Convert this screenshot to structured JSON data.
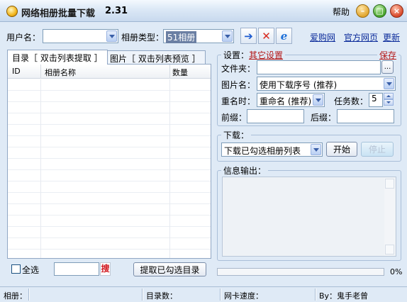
{
  "window": {
    "title": "网络相册批量下载",
    "version": "2.31",
    "help": "帮助"
  },
  "top": {
    "username_label": "用户名：",
    "username_value": "",
    "album_type_label": "相册类型：",
    "album_type_value": "51相册",
    "links": [
      "爱购网",
      "官方网页",
      "更新"
    ]
  },
  "left": {
    "tabs": [
      "目录［ 双击列表提取 ］",
      "图片［ 双击列表预览 ］"
    ],
    "columns": [
      "ID",
      "相册名称",
      "数量"
    ],
    "select_all": "全选",
    "search_button": "搜",
    "search_value": "",
    "extract_button": "提取已勾选目录"
  },
  "settings": {
    "title": "设置：",
    "other_settings": "其它设置",
    "save": "保存",
    "folder_label": "文件夹：",
    "folder_value": "",
    "browse": "...",
    "picname_label": "图片名：",
    "picname_value": "使用下载序号 (推荐)",
    "rename_label": "重名时：",
    "rename_value": "重命名 (推荐)",
    "tasks_label": "任务数：",
    "tasks_value": "5",
    "prefix_label": "前缀：",
    "prefix_value": "",
    "suffix_label": "后缀：",
    "suffix_value": ""
  },
  "download": {
    "title": "下载：",
    "mode_value": "下载已勾选相册列表",
    "start": "开始",
    "stop": "停止"
  },
  "info": {
    "title": "信息输出："
  },
  "progress": {
    "percent_label": "0%",
    "value": 0
  },
  "statusbar": {
    "album": "相册：",
    "dir_count": "目录数：",
    "net_speed": "网卡速度：",
    "author": "By：鬼手老曾"
  }
}
